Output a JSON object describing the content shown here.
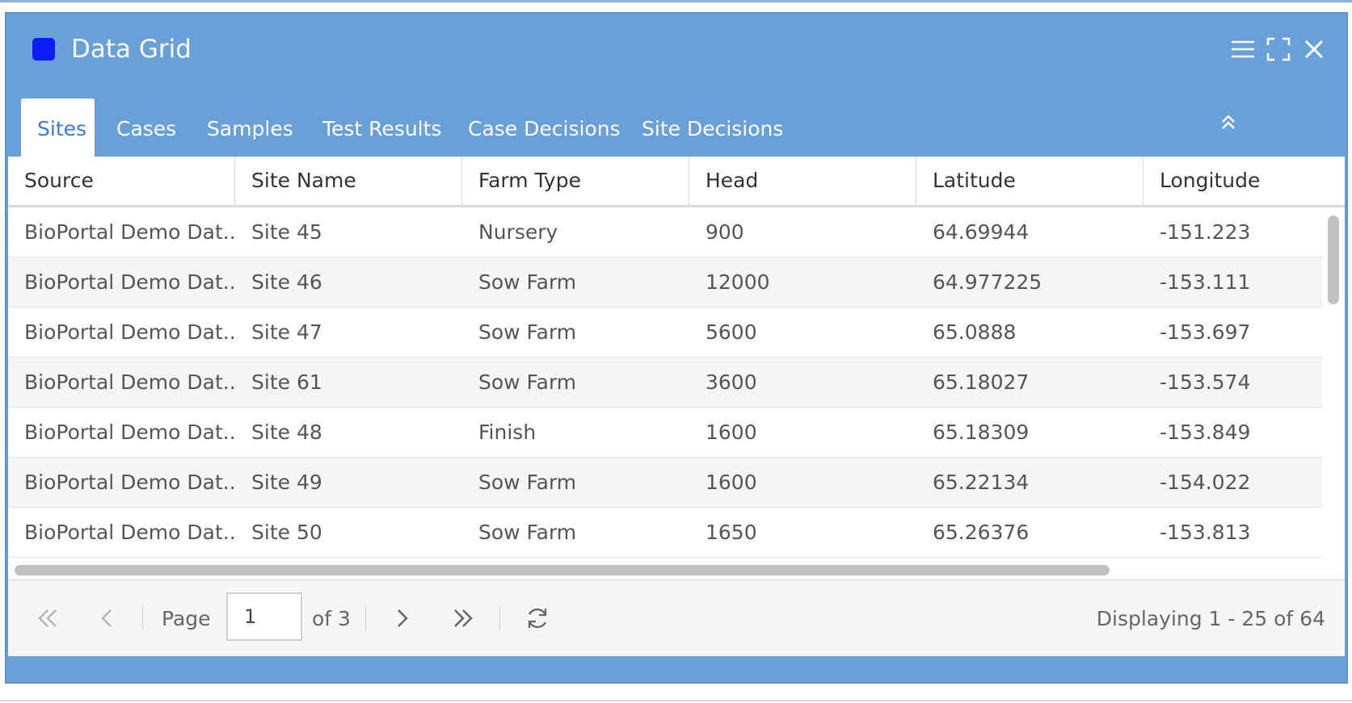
{
  "window": {
    "title": "Data Grid",
    "accent_color": "#6aa0d8",
    "icon_color": "#0a1ef5",
    "tools": [
      "menu-icon",
      "maximize-icon",
      "close-icon"
    ]
  },
  "tabs": [
    {
      "label": "Sites",
      "active": true
    },
    {
      "label": "Cases",
      "active": false
    },
    {
      "label": "Samples",
      "active": false
    },
    {
      "label": "Test Results",
      "active": false
    },
    {
      "label": "Case Decisions",
      "active": false
    },
    {
      "label": "Site Decisions",
      "active": false
    }
  ],
  "grid": {
    "columns": [
      "Source",
      "Site Name",
      "Farm Type",
      "Head",
      "Latitude",
      "Longitude"
    ],
    "rows": [
      [
        "BioPortal Demo Dat...",
        "Site 45",
        "Nursery",
        "900",
        "64.69944",
        "-151.223"
      ],
      [
        "BioPortal Demo Dat...",
        "Site 46",
        "Sow Farm",
        "12000",
        "64.977225",
        "-153.111"
      ],
      [
        "BioPortal Demo Dat...",
        "Site 47",
        "Sow Farm",
        "5600",
        "65.0888",
        "-153.697"
      ],
      [
        "BioPortal Demo Dat...",
        "Site 61",
        "Sow Farm",
        "3600",
        "65.18027",
        "-153.574"
      ],
      [
        "BioPortal Demo Dat...",
        "Site 48",
        "Finish",
        "1600",
        "65.18309",
        "-153.849"
      ],
      [
        "BioPortal Demo Dat...",
        "Site 49",
        "Sow Farm",
        "1600",
        "65.22134",
        "-154.022"
      ],
      [
        "BioPortal Demo Dat...",
        "Site 50",
        "Sow Farm",
        "1650",
        "65.26376",
        "-153.813"
      ]
    ]
  },
  "pager": {
    "page_label": "Page",
    "page_value": "1",
    "of_label": "of 3",
    "display_text": "Displaying 1 - 25 of 64"
  }
}
